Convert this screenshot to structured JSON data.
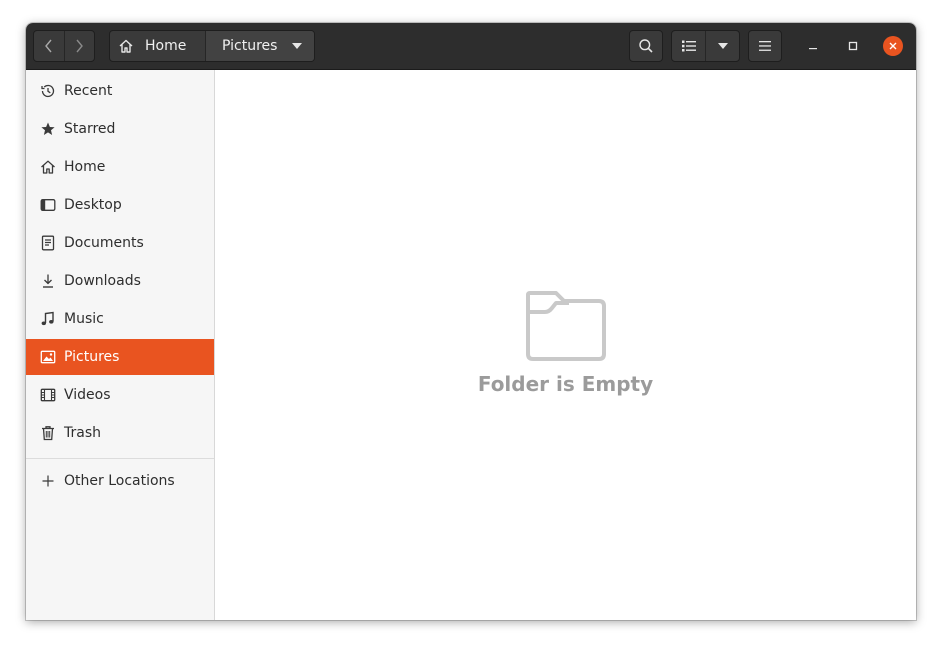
{
  "header": {
    "back_tooltip": "Back",
    "forward_tooltip": "Forward",
    "path": [
      {
        "label": "Home"
      },
      {
        "label": "Pictures"
      }
    ]
  },
  "sidebar": {
    "items": [
      {
        "label": "Recent",
        "icon": "clock-icon"
      },
      {
        "label": "Starred",
        "icon": "star-icon"
      },
      {
        "label": "Home",
        "icon": "home-icon"
      },
      {
        "label": "Desktop",
        "icon": "desktop-icon"
      },
      {
        "label": "Documents",
        "icon": "document-icon"
      },
      {
        "label": "Downloads",
        "icon": "download-icon"
      },
      {
        "label": "Music",
        "icon": "music-note-icon"
      },
      {
        "label": "Pictures",
        "icon": "picture-icon",
        "active": true
      },
      {
        "label": "Videos",
        "icon": "film-icon"
      },
      {
        "label": "Trash",
        "icon": "trash-icon"
      }
    ],
    "other": {
      "label": "Other Locations",
      "icon": "plus-icon"
    }
  },
  "content": {
    "empty_message": "Folder is Empty"
  },
  "colors": {
    "accent": "#e95420",
    "headerbar": "#2d2d2d",
    "sidebar_bg": "#f6f6f6",
    "empty_text": "#9b9b9b"
  }
}
